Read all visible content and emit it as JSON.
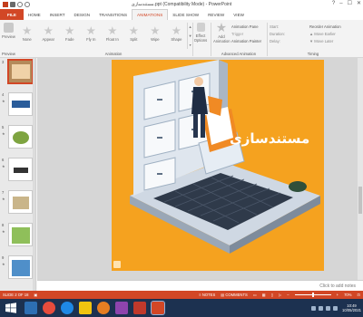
{
  "title_bar": {
    "title": "(Compatibility Mode) - PowerPoint",
    "title_prefix_rtl": "مستندسازی.ppt",
    "minimize": "–",
    "maximize": "☐",
    "close": "✕",
    "help": "?"
  },
  "tabs": [
    {
      "label": "FILE"
    },
    {
      "label": "HOME"
    },
    {
      "label": "INSERT"
    },
    {
      "label": "DESIGN"
    },
    {
      "label": "TRANSITIONS"
    },
    {
      "label": "ANIMATIONS"
    },
    {
      "label": "SLIDE SHOW"
    },
    {
      "label": "REVIEW"
    },
    {
      "label": "VIEW"
    }
  ],
  "ribbon": {
    "preview_label": "Preview",
    "animations": [
      "None",
      "Appear",
      "Fade",
      "Fly In",
      "Float In",
      "Split",
      "Wipe",
      "Shape"
    ],
    "effect_options_label": "Effect Options",
    "add_animation_label": "Add Animation",
    "advanced": {
      "pane": "Animation Pane",
      "trigger": "Trigger",
      "painter": "Animation Painter"
    },
    "timing": {
      "start": "Start:",
      "duration": "Duration:",
      "delay": "Delay:"
    },
    "reorder": {
      "title": "Reorder Animation",
      "earlier": "▲ Move Earlier",
      "later": "▼ Move Later"
    },
    "group_labels": {
      "preview": "Preview",
      "animation": "Animation",
      "advanced": "Advanced Animation",
      "timing": "Timing"
    }
  },
  "slides_panel": {
    "numbers": [
      "3",
      "4",
      "5",
      "6",
      "7",
      "8",
      "9"
    ],
    "selected": "3"
  },
  "slide": {
    "title": "مستندسازی"
  },
  "notes": {
    "placeholder": "Click to add notes"
  },
  "status_bar": {
    "slide_info": "SLIDE 2 OF 18",
    "notes_label": "NOTES",
    "comments_label": "COMMENTS",
    "zoom": "70%"
  },
  "taskbar": {
    "time": "10:49",
    "date": "10/05/2021"
  },
  "colors": {
    "accent": "#d24726",
    "slide_bg": "#f5a21f",
    "taskbar": "#1c3150"
  }
}
